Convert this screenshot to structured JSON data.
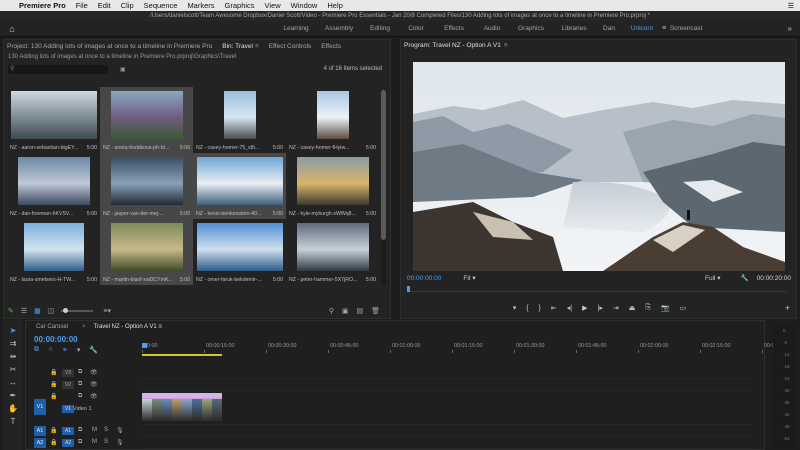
{
  "menubar": {
    "apple": "",
    "app": "Premiere Pro",
    "items": [
      "File",
      "Edit",
      "Clip",
      "Sequence",
      "Markers",
      "Graphics",
      "View",
      "Window",
      "Help"
    ],
    "right": "☰"
  },
  "titlebar": "/Users/danielscott/Team Awesome Dropbox/Daniel Scott/Video - Premiere Pro Essentials - Jan 20/8 Completed Files/130 Adding lots of images at once to a timeline in Premiere Pro.prproj *",
  "workspaces": {
    "home": "⌂",
    "tabs": [
      "Learning",
      "Assembly",
      "Editing",
      "Color",
      "Effects",
      "Audio",
      "Graphics",
      "Libraries",
      "Dan",
      "Unicorn",
      "Screencast"
    ],
    "active": "Unicorn",
    "active_mark": "≡",
    "more": "»"
  },
  "project": {
    "tab_project": "Project: 130 Adding lots of images at once to a timeline in Premiere Pro",
    "tab_bin": "Bin: Travel",
    "tab_effect_controls": "Effect Controls",
    "tab_effects": "Effects",
    "menu_icon": "≡",
    "path": "130 Adding lots of images at once to a timeline in Premiere Pro.prproj\\Graphics\\Travel",
    "search_placeholder": "",
    "items_selected": "4 of 16 items selected",
    "items": [
      {
        "name": "NZ - aaron-sebastian-btgEY...",
        "dur": "5:00"
      },
      {
        "name": "NZ - aneta-foubikova-ph-Id...",
        "dur": "5:00"
      },
      {
        "name": "NZ - casey-horner-75_s8i...",
        "dur": "5:00"
      },
      {
        "name": "NZ - casey-horner-fHyiw...",
        "dur": "5:00"
      },
      {
        "name": "NZ - dan-freeman-hKVSV...",
        "dur": "5:00"
      },
      {
        "name": "NZ - jasper-van-der-mej-...",
        "dur": "5:00"
      },
      {
        "name": "NZ - kevin-benkenstein-40...",
        "dur": "5:00"
      },
      {
        "name": "NZ - kyle-myburgh-zWWq8...",
        "dur": "5:00"
      },
      {
        "name": "NZ - laura-smetsers-H-TW...",
        "dur": "5:00"
      },
      {
        "name": "NZ - martin-bisof-xsiDCYmK...",
        "dur": "5:00"
      },
      {
        "name": "NZ - omer-faruk-bekdemir-...",
        "dur": "5:00"
      },
      {
        "name": "NZ - peter-hammer-5X7jRO...",
        "dur": "5:00"
      }
    ]
  },
  "program": {
    "title": "Program: Travel NZ - Option A V1",
    "menu_icon": "≡",
    "timecode": "00:00:00:00",
    "fit": "Fit",
    "quality": "Full",
    "duration": "00:00:20:00",
    "playhead_fraction": 0
  },
  "timeline": {
    "tab_car": "Car Carosel",
    "tab_seq": "Travel NZ - Option A V1",
    "close": "×",
    "menu_icon": "≡",
    "timecode": "00:00:00:00",
    "ticks": [
      "00:00",
      "00:00:15:00",
      "00:00:30:00",
      "00:00:45:00",
      "00:01:00:00",
      "00:01:15:00",
      "00:01:30:00",
      "00:01:45:00",
      "00:02:00:00",
      "00:02:15:00",
      "00:02"
    ],
    "tracks": {
      "v3": "V3",
      "v2": "V2",
      "v1": "V1",
      "v1_patch": "V1",
      "video1_label": "Video 1",
      "a1": "A1",
      "a1_patch": "A1",
      "a2": "A2",
      "a2_patch": "A2",
      "m": "M",
      "s": "S"
    }
  },
  "vu_marks": [
    "0",
    "-6",
    "-12",
    "-18",
    "-24",
    "-30",
    "-36",
    "-42",
    "-48",
    "-54"
  ]
}
